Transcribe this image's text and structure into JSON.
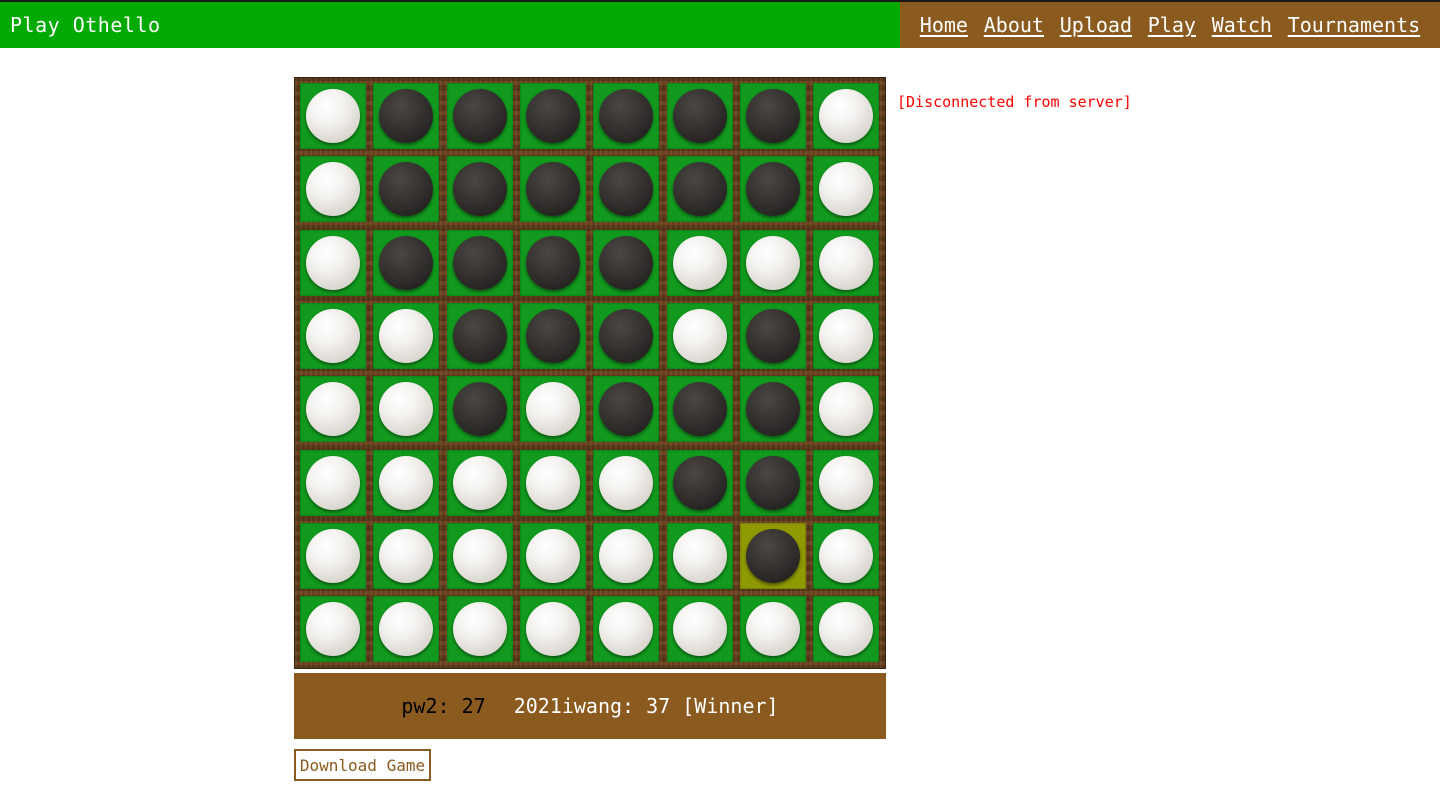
{
  "header": {
    "title": "Play Othello",
    "nav": [
      "Home",
      "About",
      "Upload",
      "Play",
      "Watch",
      "Tournaments"
    ]
  },
  "colors": {
    "header_green": "#00aa00",
    "nav_brown": "#8b5a1f",
    "cell_green": "#119a1d",
    "last_move_highlight": "#8f9a00",
    "status_red": "#ff0000"
  },
  "status_message": "[Disconnected from server]",
  "board": {
    "rows": [
      "WBBBBBBW",
      "WBBBBBBW",
      "WBBBBWWW",
      "WWBBBWBW",
      "WWBWBBBW",
      "WWWWWBBW",
      "WWWWWWBW",
      "WWWWWWWW"
    ],
    "last_move": {
      "row": 6,
      "col": 6
    }
  },
  "score": {
    "black_player": "pw2: 27",
    "white_player": "2021iwang: 37 [Winner]"
  },
  "download_label": "Download Game"
}
